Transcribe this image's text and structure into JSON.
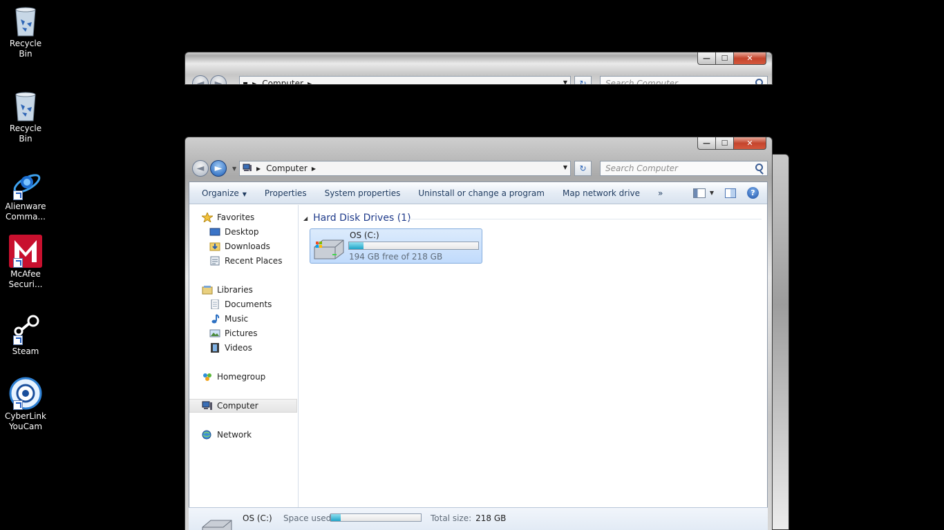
{
  "desktop": {
    "icons": [
      {
        "label": "Recycle Bin"
      },
      {
        "label": "Recycle Bin"
      },
      {
        "label": "Alienware Comma..."
      },
      {
        "label": "McAfee Securi..."
      },
      {
        "label": "Steam"
      },
      {
        "label": "CyberLink YouCam"
      }
    ]
  },
  "window_back": {
    "address": "Computer",
    "search_placeholder": "Search Computer"
  },
  "window": {
    "address": "Computer",
    "search_placeholder": "Search Computer",
    "caption": {
      "minimize": "—",
      "maximize": "☐",
      "close": "✕"
    }
  },
  "toolbar": {
    "organize": "Organize",
    "properties": "Properties",
    "system_properties": "System properties",
    "uninstall": "Uninstall or change a program",
    "map_drive": "Map network drive",
    "more": "»",
    "help": "?"
  },
  "nav": {
    "favorites": "Favorites",
    "desktop": "Desktop",
    "downloads": "Downloads",
    "recent": "Recent Places",
    "libraries": "Libraries",
    "documents": "Documents",
    "music": "Music",
    "pictures": "Pictures",
    "videos": "Videos",
    "homegroup": "Homegroup",
    "computer": "Computer",
    "network": "Network"
  },
  "content": {
    "group_title": "Hard Disk Drives (1)",
    "drive": {
      "name": "OS (C:)",
      "free_text": "194 GB free of 218 GB",
      "used_fraction": 0.11
    }
  },
  "details": {
    "name": "OS (C:)",
    "space_used_label": "Space used:",
    "total_size_label": "Total size:",
    "total_size": "218 GB"
  },
  "colors": {
    "accent": "#1ea4c8",
    "link_text": "#1e3a8a"
  }
}
